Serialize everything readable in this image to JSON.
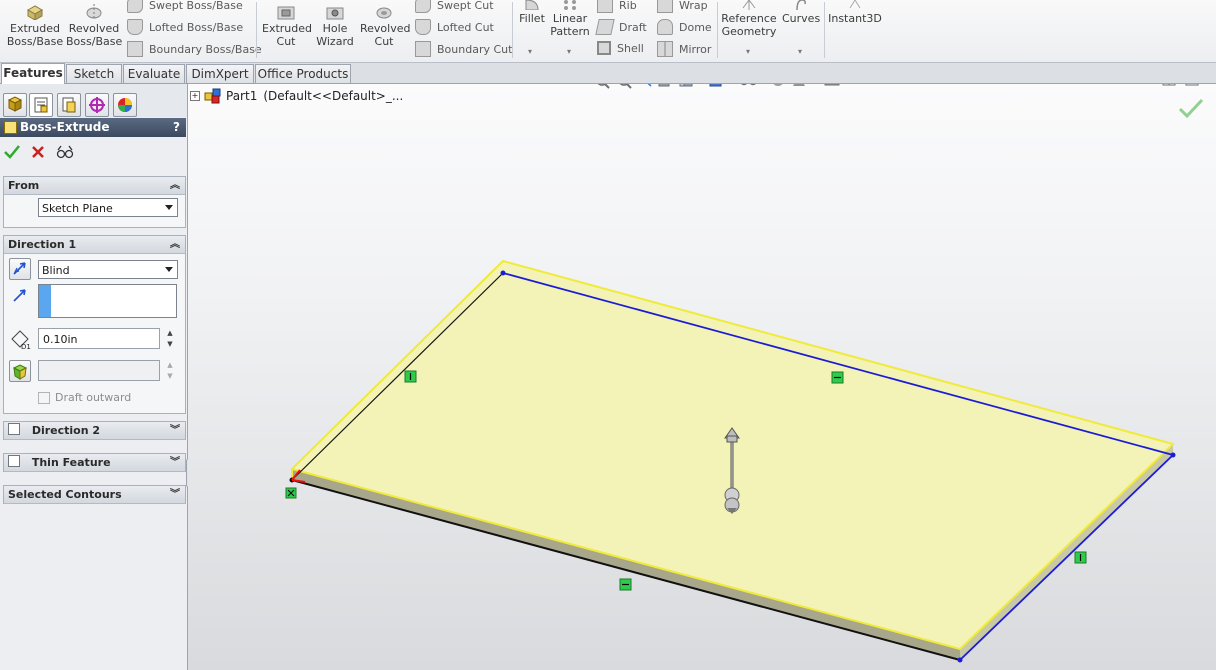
{
  "ribbon": {
    "extruded_boss": "Extruded Boss/Base",
    "revolved_boss": "Revolved Boss/Base",
    "swept_boss": "Swept Boss/Base",
    "lofted_boss": "Lofted Boss/Base",
    "boundary_boss": "Boundary Boss/Base",
    "extruded_cut": "Extruded Cut",
    "hole_wizard": "Hole Wizard",
    "revolved_cut": "Revolved Cut",
    "swept_cut": "Swept Cut",
    "lofted_cut": "Lofted Cut",
    "boundary_cut": "Boundary Cut",
    "fillet": "Fillet",
    "linear_pattern": "Linear Pattern",
    "rib": "Rib",
    "draft": "Draft",
    "shell": "Shell",
    "wrap": "Wrap",
    "dome": "Dome",
    "mirror": "Mirror",
    "reference_geometry": "Reference Geometry",
    "curves": "Curves",
    "instant3d": "Instant3D"
  },
  "tabs": [
    "Features",
    "Sketch",
    "Evaluate",
    "DimXpert",
    "Office Products"
  ],
  "property_manager": {
    "title": "Boss-Extrude",
    "help": "?",
    "from": {
      "header": "From",
      "value": "Sketch Plane"
    },
    "direction1": {
      "header": "Direction 1",
      "end_condition": "Blind",
      "depth": "0.10in",
      "draft_outward": "Draft outward"
    },
    "direction2": {
      "header": "Direction 2"
    },
    "thin_feature": {
      "header": "Thin Feature"
    },
    "selected_contours": {
      "header": "Selected Contours"
    }
  },
  "tree": {
    "part_label": "Part1",
    "config": "(Default<<Default>_..."
  },
  "colors": {
    "face": "#f3f3b8",
    "edge_highlight": "#f0ea3a",
    "edge_selected": "#1c1cd6",
    "constraint": "#2fcc4a",
    "accept": "#2faa2f",
    "cancel": "#cc1f1f"
  }
}
